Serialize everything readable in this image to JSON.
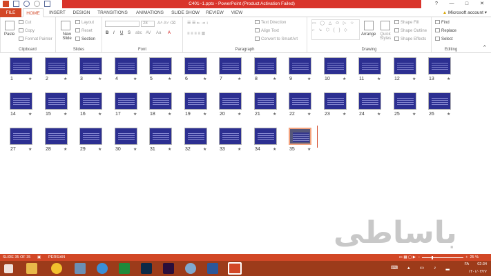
{
  "window": {
    "title": "C401~1.pptx - PowerPoint (Product Activation Failed)",
    "controls": [
      "?",
      "—",
      "□",
      "✕"
    ]
  },
  "tabs": [
    "FILE",
    "HOME",
    "INSERT",
    "DESIGN",
    "TRANSITIONS",
    "ANIMATIONS",
    "SLIDE SHOW",
    "REVIEW",
    "VIEW"
  ],
  "account": "Microsoft account",
  "ribbon": {
    "clipboard": {
      "label": "Clipboard",
      "paste": "Paste",
      "cut": "Cut",
      "copy": "Copy",
      "format_painter": "Format Painter"
    },
    "slides": {
      "label": "Slides",
      "new_slide": "New Slide",
      "layout": "Layout",
      "reset": "Reset",
      "section": "Section"
    },
    "font": {
      "label": "Font",
      "size": "28"
    },
    "paragraph": {
      "label": "Paragraph",
      "text_direction": "Text Direction",
      "align_text": "Align Text",
      "smartart": "Convert to SmartArt"
    },
    "drawing": {
      "label": "Drawing",
      "arrange": "Arrange",
      "quick_styles": "Quick Styles",
      "shape_fill": "Shape Fill",
      "shape_outline": "Shape Outline",
      "shape_effects": "Shape Effects"
    },
    "editing": {
      "label": "Editing",
      "find": "Find",
      "replace": "Replace",
      "select": "Select"
    }
  },
  "slides": [
    "1",
    "2",
    "3",
    "4",
    "5",
    "6",
    "7",
    "8",
    "9",
    "10",
    "11",
    "12",
    "13",
    "14",
    "15",
    "16",
    "17",
    "18",
    "19",
    "20",
    "21",
    "22",
    "23",
    "24",
    "25",
    "26",
    "27",
    "28",
    "29",
    "30",
    "31",
    "32",
    "33",
    "34",
    "35"
  ],
  "slide_marker": "★",
  "watermark": "باساطی",
  "status": {
    "slide": "SLIDE 35 OF 35",
    "language": "PERSIAN",
    "zoom": "25 %"
  },
  "tray": {
    "lang": "FA",
    "time": "02:34",
    "date": "۱۴۰۱/۰۳/۲۷"
  }
}
